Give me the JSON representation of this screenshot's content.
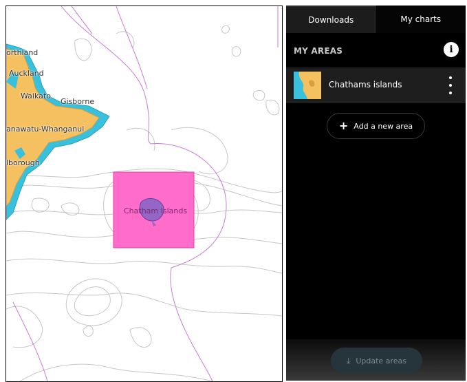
{
  "map": {
    "place_labels": [
      "orthland",
      "Auckland",
      "Waikato",
      "Gisborne",
      "anawatu-Whanganui",
      "lborough"
    ],
    "selected_area_label": "Chatham Islands",
    "land_color": "#f4c060",
    "water_color": "#38c0dc",
    "selection_color": "#ff6cc9"
  },
  "tabs": [
    {
      "label": "Downloads",
      "active": true
    },
    {
      "label": "My charts",
      "active": false
    }
  ],
  "sidebar": {
    "heading": "MY AREAS",
    "info_icon_text": "i",
    "areas": [
      {
        "name": "Chathams islands"
      }
    ],
    "add_button_label": "Add a new area",
    "update_button_label": "Update areas"
  },
  "icons": {
    "info": "info-icon",
    "menu": "more-vertical-icon",
    "add": "plus-icon",
    "update": "download-icon"
  }
}
